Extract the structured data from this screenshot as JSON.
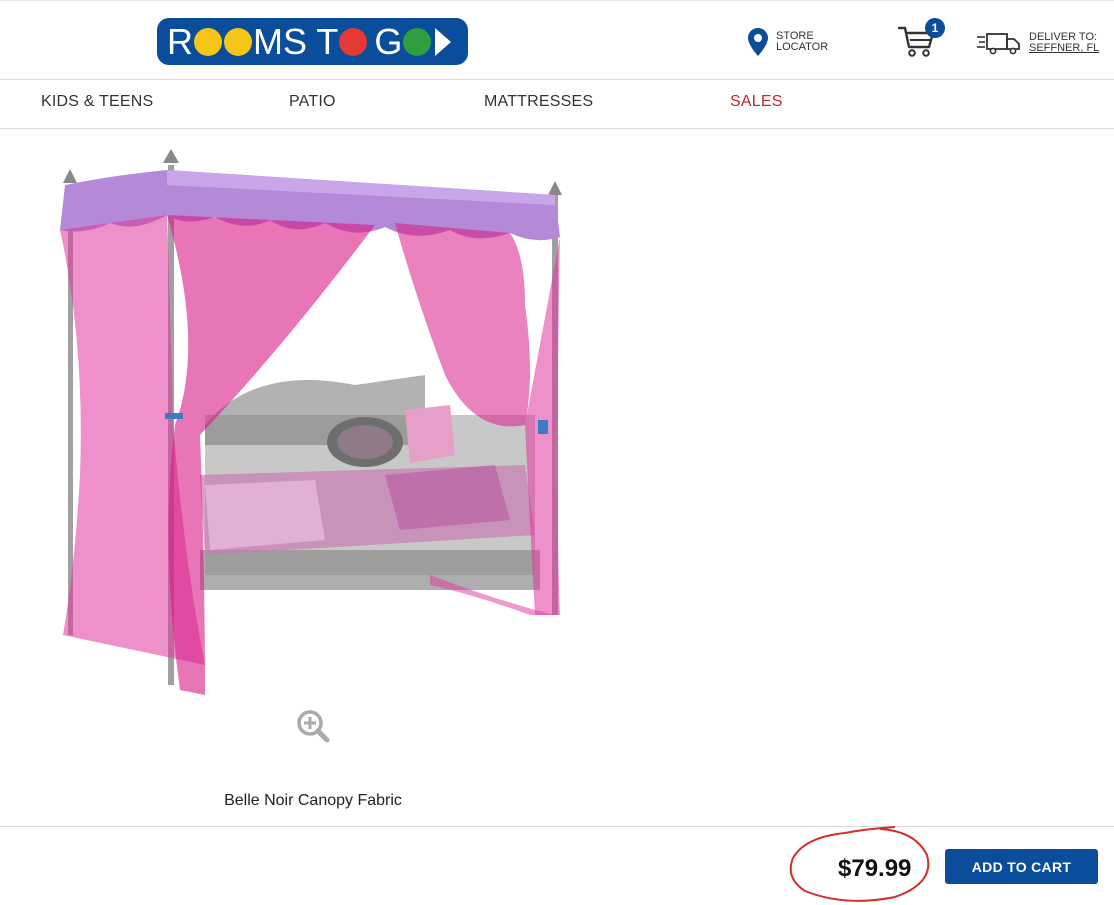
{
  "brand": {
    "logo_text": "ROOMS TO GO",
    "logo_prefix": "R",
    "logo_middle": "MS T",
    "logo_suffix": "G",
    "bg_color": "#0a4d9b",
    "dot_colors": [
      "#f5c518",
      "#f5c518",
      "#e53935",
      "#2e9e3f"
    ]
  },
  "header": {
    "store_line1": "STORE",
    "store_line2": "LOCATOR",
    "cart_count": "1",
    "deliver_line1": "DELIVER TO:",
    "deliver_line2": "SEFFNER, FL"
  },
  "nav": {
    "items": [
      {
        "label": "KIDS & TEENS"
      },
      {
        "label": "PATIO"
      },
      {
        "label": "MATTRESSES"
      },
      {
        "label": "SALES"
      }
    ]
  },
  "product": {
    "name": "Belle Noir Canopy Fabric",
    "price": "$79.99",
    "add_to_cart_label": "ADD TO CART",
    "zoom_icon": "zoom-in-icon"
  },
  "colors": {
    "accent": "#0a4d9b",
    "sales": "#c1272d",
    "annotation": "#d32f2f"
  }
}
